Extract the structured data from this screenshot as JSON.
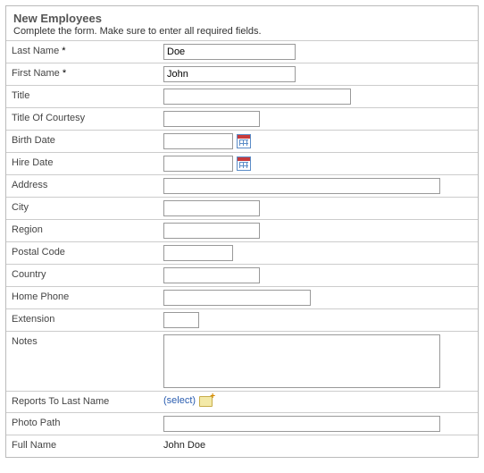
{
  "header": {
    "title": "New Employees",
    "instructions": "Complete the form. Make sure to enter all required fields."
  },
  "fields": {
    "last_name": {
      "label": "Last Name",
      "required": "*",
      "value": "Doe"
    },
    "first_name": {
      "label": "First Name",
      "required": "*",
      "value": "John"
    },
    "title_job": {
      "label": "Title",
      "value": ""
    },
    "courtesy": {
      "label": "Title Of Courtesy",
      "value": ""
    },
    "birth_date": {
      "label": "Birth Date",
      "value": ""
    },
    "hire_date": {
      "label": "Hire Date",
      "value": ""
    },
    "address": {
      "label": "Address",
      "value": ""
    },
    "city": {
      "label": "City",
      "value": ""
    },
    "region": {
      "label": "Region",
      "value": ""
    },
    "postal": {
      "label": "Postal Code",
      "value": ""
    },
    "country": {
      "label": "Country",
      "value": ""
    },
    "home_phone": {
      "label": "Home Phone",
      "value": ""
    },
    "extension": {
      "label": "Extension",
      "value": ""
    },
    "notes": {
      "label": "Notes",
      "value": ""
    },
    "reports_to": {
      "label": "Reports To Last Name",
      "select_text": "(select)"
    },
    "photo_path": {
      "label": "Photo Path",
      "value": ""
    },
    "full_name": {
      "label": "Full Name",
      "value": "John Doe"
    }
  }
}
